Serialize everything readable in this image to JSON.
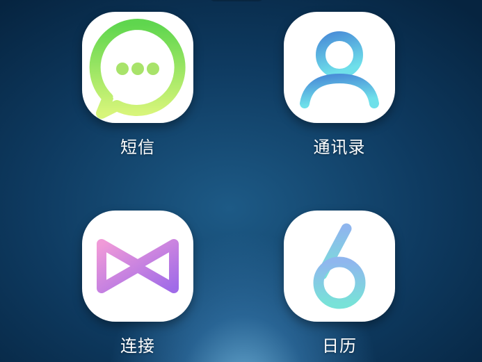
{
  "apps": [
    {
      "label": "短信",
      "icon": "message-bubble-icon",
      "colors": [
        "#5fd64e",
        "#d7f57a"
      ]
    },
    {
      "label": "通讯录",
      "icon": "contact-person-icon",
      "colors": [
        "#4a8fd8",
        "#6fe0ea"
      ]
    },
    {
      "label": "连接",
      "icon": "bowtie-connect-icon",
      "colors": [
        "#f09ad8",
        "#a06be8"
      ]
    },
    {
      "label": "日历",
      "icon": "calendar-six-icon",
      "colors": [
        "#8fb6ee",
        "#78e2d8"
      ]
    }
  ]
}
